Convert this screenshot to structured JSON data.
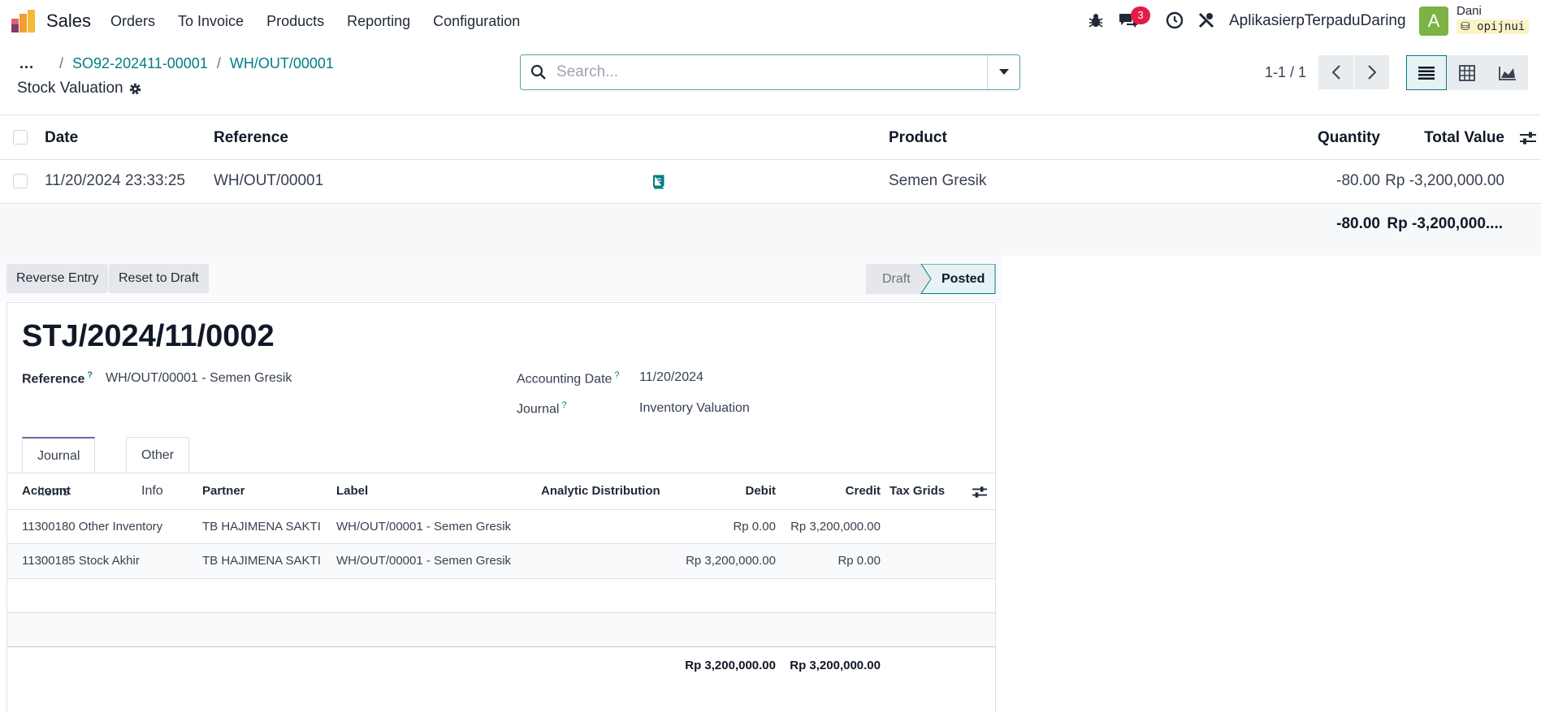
{
  "navbar": {
    "app_name": "Sales",
    "menu": [
      "Orders",
      "To Invoice",
      "Products",
      "Reporting",
      "Configuration"
    ],
    "messages_count": "3",
    "company": "AplikasierpTerpaduDaring",
    "avatar_letter": "A",
    "user_name": "Dani",
    "database": "opijnui"
  },
  "breadcrumb": {
    "dots": "...",
    "items": [
      "SO92-202411-00001",
      "WH/OUT/00001"
    ],
    "separator": "/",
    "current": "Stock Valuation"
  },
  "search": {
    "placeholder": "Search..."
  },
  "pager": {
    "text": "1-1 / 1"
  },
  "list": {
    "headers": {
      "date": "Date",
      "reference": "Reference",
      "product": "Product",
      "quantity": "Quantity",
      "total_value": "Total Value"
    },
    "row": {
      "date": "11/20/2024 23:33:25",
      "reference": "WH/OUT/00001",
      "product": "Semen Gresik",
      "quantity": "-80.00",
      "total_value": "Rp -3,200,000.00"
    },
    "totals": {
      "quantity": "-80.00",
      "total_value": "Rp -3,200,000...."
    }
  },
  "form": {
    "buttons": {
      "reverse": "Reverse Entry",
      "reset": "Reset to Draft"
    },
    "statusbar": {
      "draft": "Draft",
      "posted": "Posted"
    },
    "name": "STJ/2024/11/0002",
    "fields": {
      "reference_label": "Reference",
      "reference_value": "WH/OUT/00001 - Semen Gresik",
      "accounting_date_label": "Accounting Date",
      "accounting_date_value": "11/20/2024",
      "journal_label": "Journal",
      "journal_value": "Inventory Valuation",
      "help": "?"
    },
    "tabs": [
      "Journal Items",
      "Other Info"
    ],
    "journal_items": {
      "headers": {
        "account": "Account",
        "partner": "Partner",
        "label": "Label",
        "analytic": "Analytic Distribution",
        "debit": "Debit",
        "credit": "Credit",
        "tax_grids": "Tax Grids"
      },
      "rows": [
        {
          "account": "11300180 Other Inventory",
          "partner": "TB HAJIMENA SAKTI",
          "label": "WH/OUT/00001 - Semen Gresik",
          "debit": "Rp 0.00",
          "credit": "Rp 3,200,000.00"
        },
        {
          "account": "11300185 Stock Akhir",
          "partner": "TB HAJIMENA SAKTI",
          "label": "WH/OUT/00001 - Semen Gresik",
          "debit": "Rp 3,200,000.00",
          "credit": "Rp 0.00"
        }
      ],
      "totals": {
        "debit": "Rp 3,200,000.00",
        "credit": "Rp 3,200,000.00"
      }
    }
  },
  "colors": {
    "primary": "#017e84",
    "badge": "#e11d48",
    "avatar": "#7cb342"
  }
}
